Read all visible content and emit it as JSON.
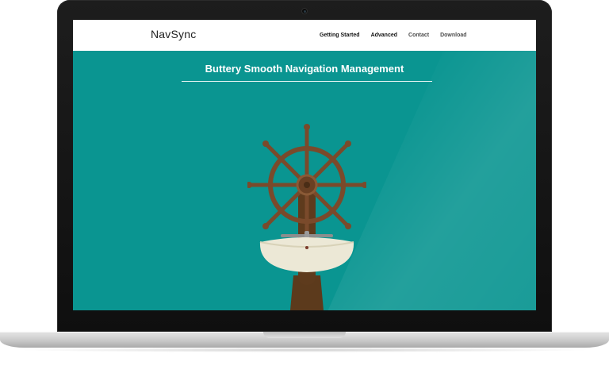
{
  "site": {
    "brand": "NavSync",
    "nav": [
      {
        "label": "Getting Started"
      },
      {
        "label": "Advanced"
      },
      {
        "label": "Contact"
      },
      {
        "label": "Download"
      }
    ]
  },
  "hero": {
    "title": "Buttery Smooth Navigation Management"
  },
  "colors": {
    "screen_bg": "#0a9591",
    "wood": "#7a4a2b",
    "sink": "#ece8d6"
  },
  "illustration": {
    "icon": "ship-wheel-sink-icon"
  }
}
